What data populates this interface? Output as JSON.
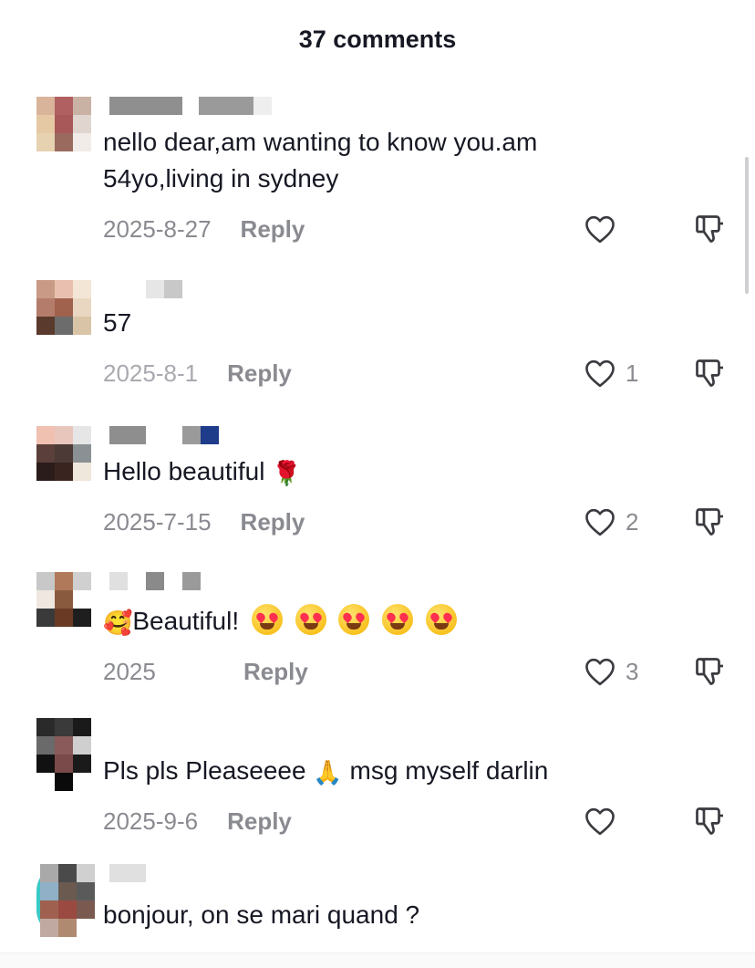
{
  "header": {
    "title": "37 comments"
  },
  "comments": [
    {
      "text": "nello dear,am wanting to know you.am 54yo,living in sydney",
      "date": "2025-8-27",
      "reply": "Reply",
      "likes": ""
    },
    {
      "text": "57",
      "date": "2025-8-1",
      "reply": "Reply",
      "likes": "1"
    },
    {
      "text": "Hello beautiful",
      "emoji": "🌹",
      "date": "2025-7-15",
      "reply": "Reply",
      "likes": "2"
    },
    {
      "text": "Beautiful!",
      "emoji_lead": "🥰",
      "date": "2025",
      "reply": "Reply",
      "likes": "3"
    },
    {
      "text_a": "Pls pls Pleaseeee",
      "emoji": "🙏",
      "text_b": "msg myself darlin",
      "date": "2025-9-6",
      "reply": "Reply",
      "likes": ""
    },
    {
      "text": "bonjour, on se mari quand ?"
    }
  ],
  "icons": {
    "like": "heart-outline-icon",
    "dislike": "thumbs-down-outline-icon"
  },
  "colors": {
    "text": "#161823",
    "secondary": "#8a8b91"
  }
}
